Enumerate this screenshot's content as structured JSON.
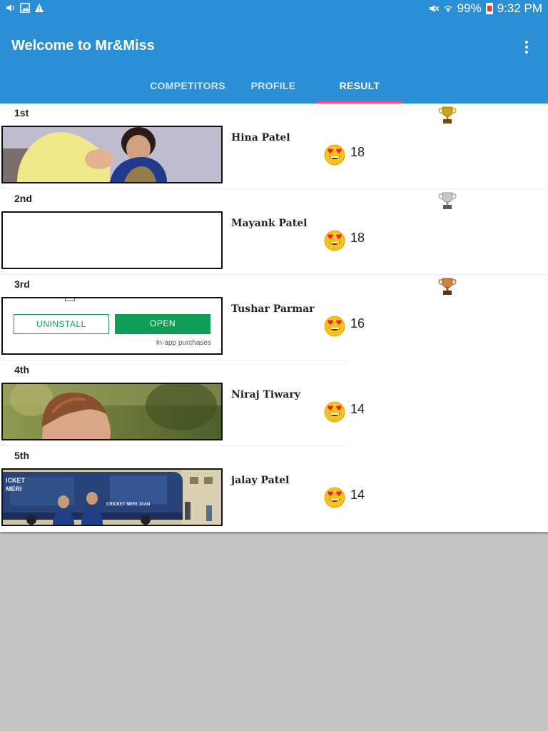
{
  "status_bar": {
    "battery": "99%",
    "time": "9:32 PM"
  },
  "app_bar": {
    "title": "Welcome to Mr&Miss",
    "menu_icon": "more-vert-icon"
  },
  "tabs": [
    {
      "label": "COMPETITORS",
      "active": false
    },
    {
      "label": "PROFILE",
      "active": false
    },
    {
      "label": "RESULT",
      "active": true
    }
  ],
  "colors": {
    "primary": "#2b8fd6",
    "tab_indicator": "#ff4b7d",
    "ad_green": "#0f9d58",
    "gold": "#d4a017",
    "silver": "#a8a8a8",
    "bronze": "#b87333"
  },
  "results": [
    {
      "rank": "1st",
      "name": "Hina Patel",
      "score": "18",
      "trophy": "gold-trophy-icon",
      "emoji": "heart-eyes-emoji"
    },
    {
      "rank": "2nd",
      "name": "Mayank Patel",
      "score": "18",
      "trophy": "silver-trophy-icon",
      "emoji": "heart-eyes-emoji"
    },
    {
      "rank": "3rd",
      "name": "Tushar Parmar",
      "score": "16",
      "trophy": "bronze-trophy-icon",
      "emoji": "heart-eyes-emoji"
    },
    {
      "rank": "4th",
      "name": "Niraj Tiwary",
      "score": "14",
      "emoji": "heart-eyes-emoji"
    },
    {
      "rank": "5th",
      "name": "jalay Patel",
      "score": "14",
      "emoji": "heart-eyes-emoji"
    }
  ],
  "ad_overlay": {
    "uninstall_label": "UNINSTALL",
    "open_label": "OPEN",
    "note": "In-app purchases"
  },
  "photo_texts": {
    "bus_text_1": "ICKET",
    "bus_text_2": "MERI",
    "bus_text_3": "CRICKET MERI JAAN"
  }
}
